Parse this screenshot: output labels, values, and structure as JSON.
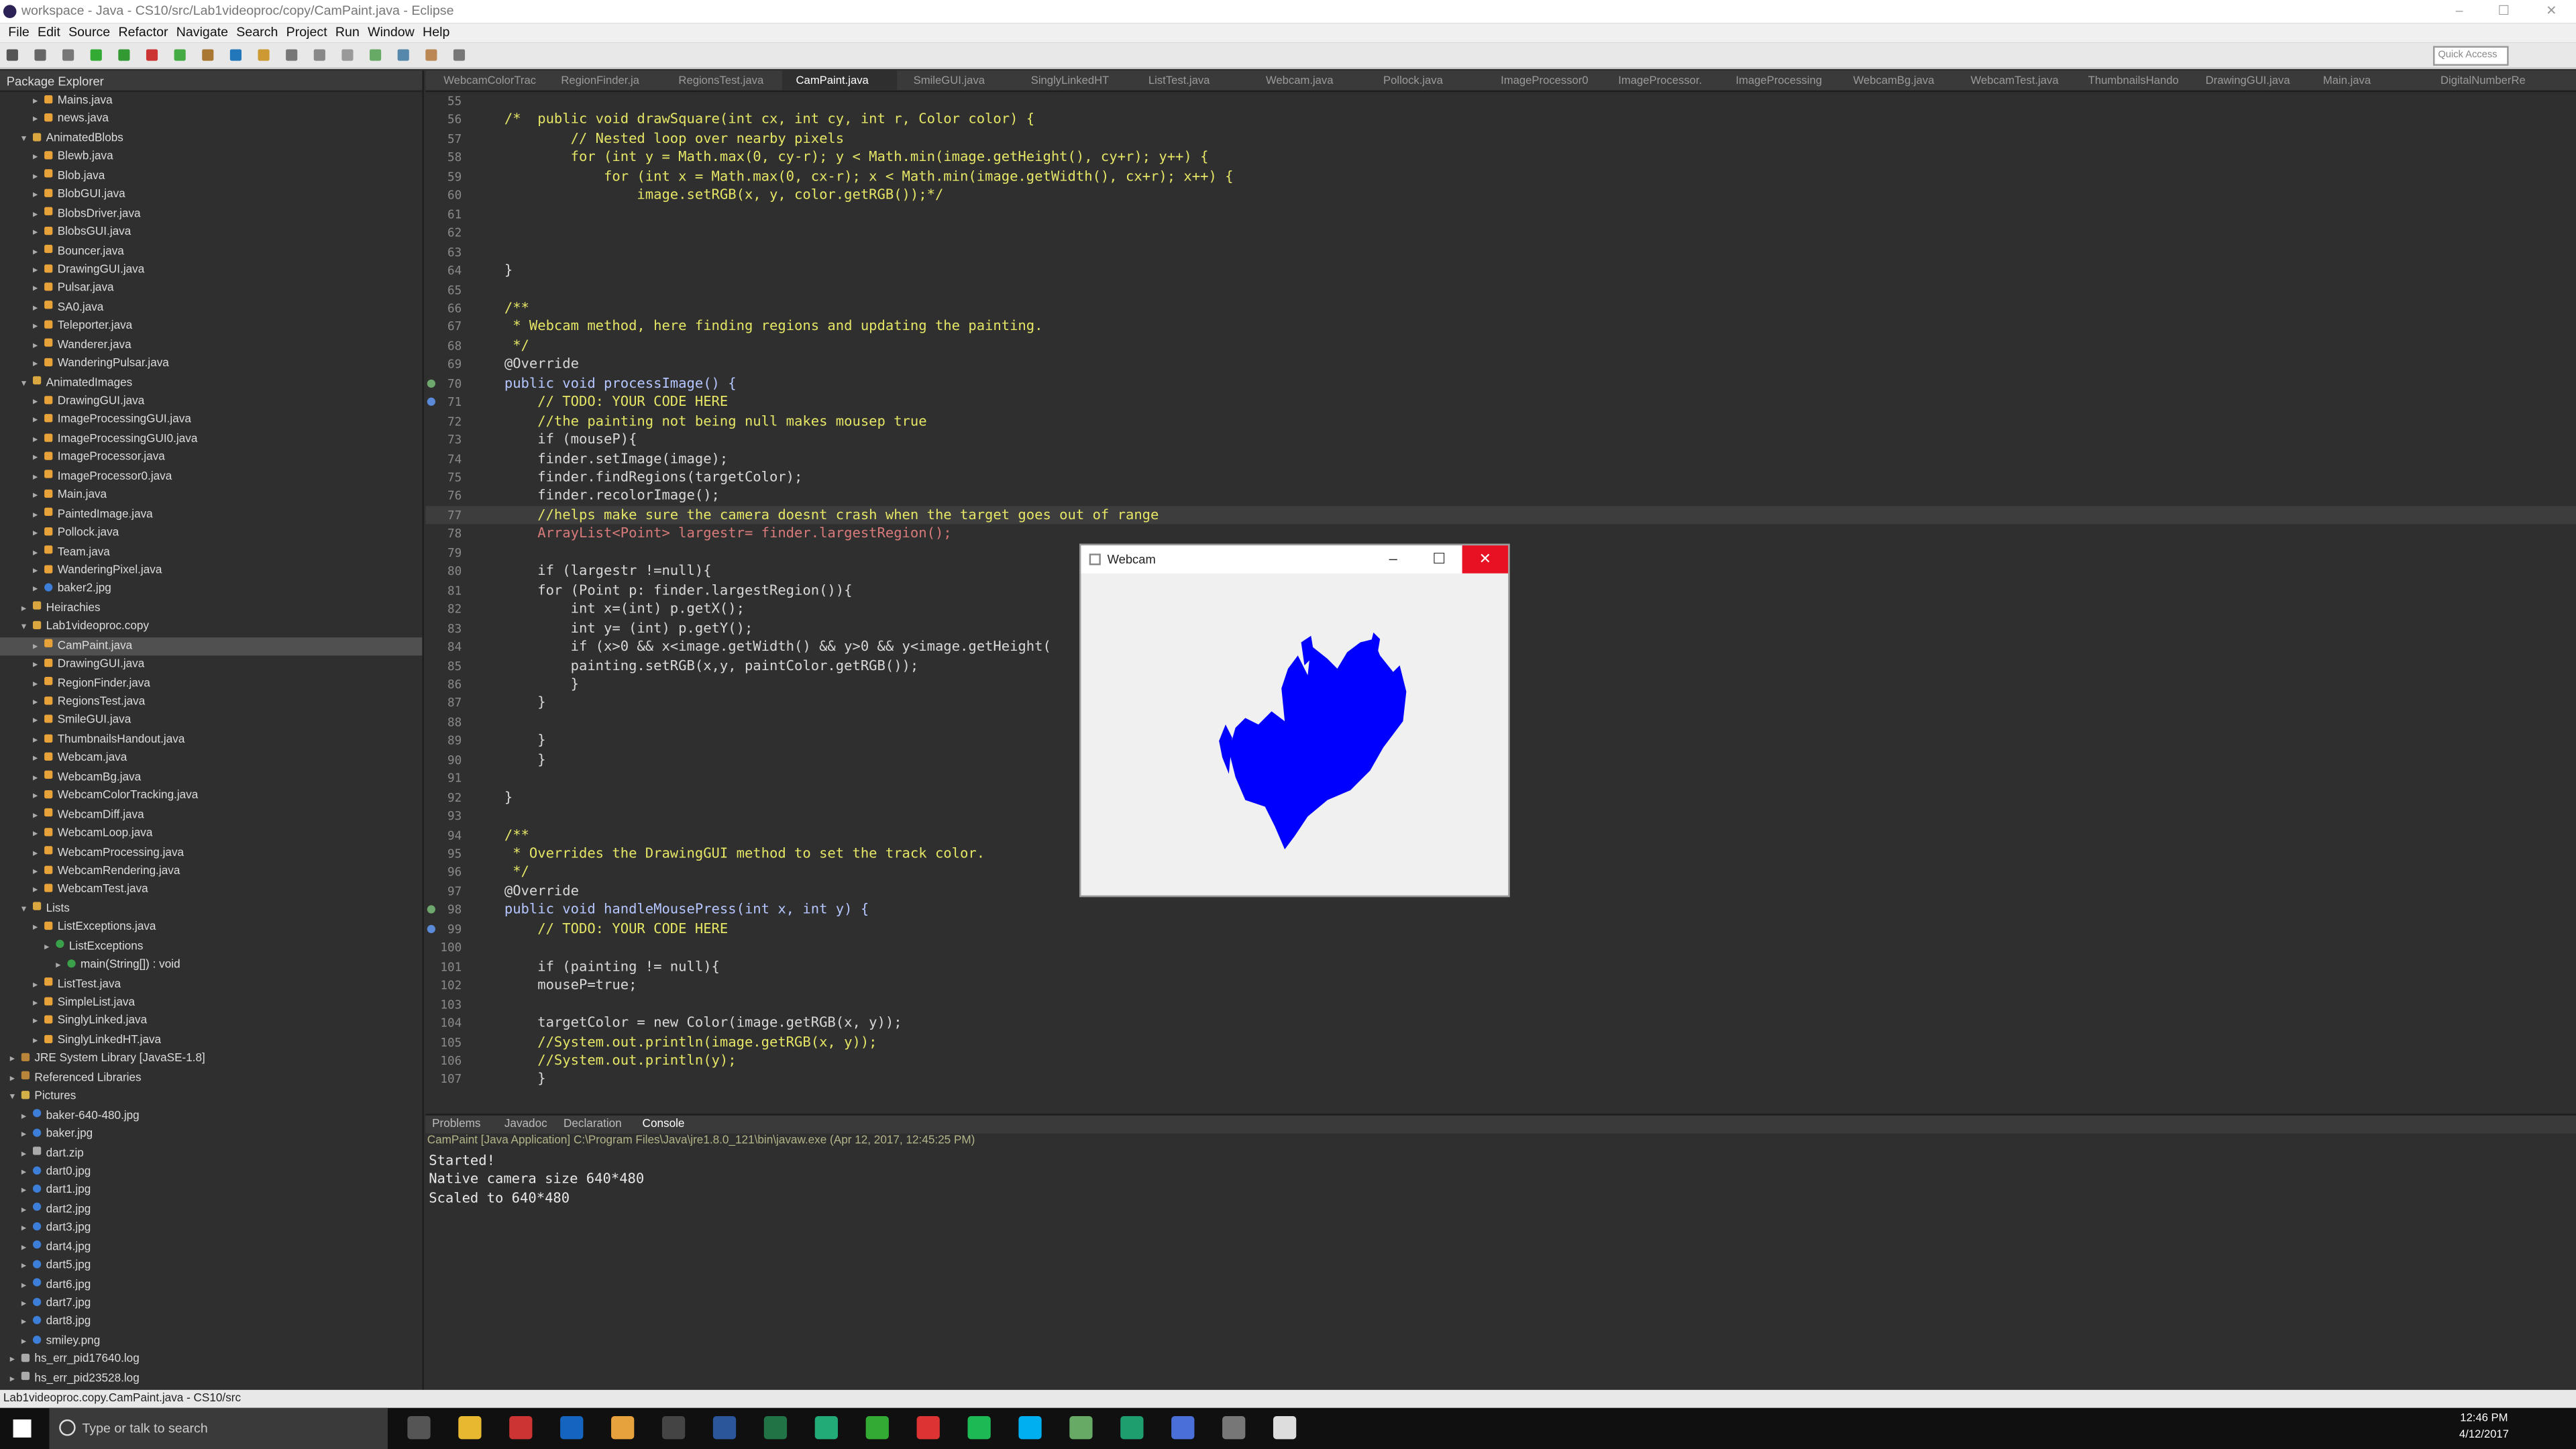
{
  "window": {
    "title": "workspace - Java - CS10/src/Lab1videoproc/copy/CamPaint.java - Eclipse",
    "quick_access": "Quick Access"
  },
  "menu": [
    "File",
    "Edit",
    "Source",
    "Refactor",
    "Navigate",
    "Search",
    "Project",
    "Run",
    "Window",
    "Help"
  ],
  "package_explorer": {
    "title": "Package Explorer"
  },
  "tree": [
    {
      "label": "Mains.java",
      "indent": 2,
      "type": "java"
    },
    {
      "label": "news.java",
      "indent": 2,
      "type": "java"
    },
    {
      "label": "AnimatedBlobs",
      "indent": 1,
      "type": "pkg",
      "open": true
    },
    {
      "label": "Blewb.java",
      "indent": 2,
      "type": "java"
    },
    {
      "label": "Blob.java",
      "indent": 2,
      "type": "java"
    },
    {
      "label": "BlobGUI.java",
      "indent": 2,
      "type": "java"
    },
    {
      "label": "BlobsDriver.java",
      "indent": 2,
      "type": "java"
    },
    {
      "label": "BlobsGUI.java",
      "indent": 2,
      "type": "java"
    },
    {
      "label": "Bouncer.java",
      "indent": 2,
      "type": "java"
    },
    {
      "label": "DrawingGUI.java",
      "indent": 2,
      "type": "java"
    },
    {
      "label": "Pulsar.java",
      "indent": 2,
      "type": "java"
    },
    {
      "label": "SA0.java",
      "indent": 2,
      "type": "java"
    },
    {
      "label": "Teleporter.java",
      "indent": 2,
      "type": "java"
    },
    {
      "label": "Wanderer.java",
      "indent": 2,
      "type": "java"
    },
    {
      "label": "WanderingPulsar.java",
      "indent": 2,
      "type": "java"
    },
    {
      "label": "AnimatedImages",
      "indent": 1,
      "type": "pkg",
      "open": true
    },
    {
      "label": "DrawingGUI.java",
      "indent": 2,
      "type": "java"
    },
    {
      "label": "ImageProcessingGUI.java",
      "indent": 2,
      "type": "java"
    },
    {
      "label": "ImageProcessingGUI0.java",
      "indent": 2,
      "type": "java"
    },
    {
      "label": "ImageProcessor.java",
      "indent": 2,
      "type": "java"
    },
    {
      "label": "ImageProcessor0.java",
      "indent": 2,
      "type": "java"
    },
    {
      "label": "Main.java",
      "indent": 2,
      "type": "java"
    },
    {
      "label": "PaintedImage.java",
      "indent": 2,
      "type": "java"
    },
    {
      "label": "Pollock.java",
      "indent": 2,
      "type": "java"
    },
    {
      "label": "Team.java",
      "indent": 2,
      "type": "java"
    },
    {
      "label": "WanderingPixel.java",
      "indent": 2,
      "type": "java"
    },
    {
      "label": "baker2.jpg",
      "indent": 2,
      "type": "img"
    },
    {
      "label": "Heirachies",
      "indent": 1,
      "type": "pkg"
    },
    {
      "label": "Lab1videoproc.copy",
      "indent": 1,
      "type": "pkg",
      "open": true
    },
    {
      "label": "CamPaint.java",
      "indent": 2,
      "type": "java",
      "selected": true
    },
    {
      "label": "DrawingGUI.java",
      "indent": 2,
      "type": "java"
    },
    {
      "label": "RegionFinder.java",
      "indent": 2,
      "type": "java"
    },
    {
      "label": "RegionsTest.java",
      "indent": 2,
      "type": "java"
    },
    {
      "label": "SmileGUI.java",
      "indent": 2,
      "type": "java"
    },
    {
      "label": "ThumbnailsHandout.java",
      "indent": 2,
      "type": "java"
    },
    {
      "label": "Webcam.java",
      "indent": 2,
      "type": "java"
    },
    {
      "label": "WebcamBg.java",
      "indent": 2,
      "type": "java"
    },
    {
      "label": "WebcamColorTracking.java",
      "indent": 2,
      "type": "java"
    },
    {
      "label": "WebcamDiff.java",
      "indent": 2,
      "type": "java"
    },
    {
      "label": "WebcamLoop.java",
      "indent": 2,
      "type": "java"
    },
    {
      "label": "WebcamProcessing.java",
      "indent": 2,
      "type": "java"
    },
    {
      "label": "WebcamRendering.java",
      "indent": 2,
      "type": "java"
    },
    {
      "label": "WebcamTest.java",
      "indent": 2,
      "type": "java"
    },
    {
      "label": "Lists",
      "indent": 1,
      "type": "pkg",
      "open": true
    },
    {
      "label": "ListExceptions.java",
      "indent": 2,
      "type": "java",
      "open": true
    },
    {
      "label": "ListExceptions",
      "indent": 3,
      "type": "class"
    },
    {
      "label": "main(String[]) : void",
      "indent": 4,
      "type": "method"
    },
    {
      "label": "ListTest.java",
      "indent": 2,
      "type": "java"
    },
    {
      "label": "SimpleList.java",
      "indent": 2,
      "type": "java"
    },
    {
      "label": "SinglyLinked.java",
      "indent": 2,
      "type": "java"
    },
    {
      "label": "SinglyLinkedHT.java",
      "indent": 2,
      "type": "java"
    },
    {
      "label": "JRE System Library [JavaSE-1.8]",
      "indent": 0,
      "type": "lib"
    },
    {
      "label": "Referenced Libraries",
      "indent": 0,
      "type": "lib"
    },
    {
      "label": "Pictures",
      "indent": 0,
      "type": "folder",
      "open": true
    },
    {
      "label": "baker-640-480.jpg",
      "indent": 1,
      "type": "img"
    },
    {
      "label": "baker.jpg",
      "indent": 1,
      "type": "img"
    },
    {
      "label": "dart.zip",
      "indent": 1,
      "type": "file"
    },
    {
      "label": "dart0.jpg",
      "indent": 1,
      "type": "img"
    },
    {
      "label": "dart1.jpg",
      "indent": 1,
      "type": "img"
    },
    {
      "label": "dart2.jpg",
      "indent": 1,
      "type": "img"
    },
    {
      "label": "dart3.jpg",
      "indent": 1,
      "type": "img"
    },
    {
      "label": "dart4.jpg",
      "indent": 1,
      "type": "img"
    },
    {
      "label": "dart5.jpg",
      "indent": 1,
      "type": "img"
    },
    {
      "label": "dart6.jpg",
      "indent": 1,
      "type": "img"
    },
    {
      "label": "dart7.jpg",
      "indent": 1,
      "type": "img"
    },
    {
      "label": "dart8.jpg",
      "indent": 1,
      "type": "img"
    },
    {
      "label": "smiley.png",
      "indent": 1,
      "type": "img"
    },
    {
      "label": "hs_err_pid17640.log",
      "indent": 0,
      "type": "file"
    },
    {
      "label": "hs_err_pid23528.log",
      "indent": 0,
      "type": "file"
    }
  ],
  "tabs": [
    "WebcamColorTrac",
    "RegionFinder.ja",
    "RegionsTest.java",
    "CamPaint.java",
    "SmileGUI.java",
    "SinglyLinkedHT",
    "ListTest.java",
    "Webcam.java",
    "Pollock.java",
    "ImageProcessor0",
    "ImageProcessor.",
    "ImageProcessing",
    "WebcamBg.java",
    "WebcamTest.java",
    "ThumbnailsHando",
    "DrawingGUI.java",
    "Main.java",
    "DigitalNumberRe"
  ],
  "active_tab": "CamPaint.java",
  "code": [
    {
      "n": "55",
      "t": "",
      "k": ""
    },
    {
      "n": "56",
      "t": "/*  public void drawSquare(int cx, int cy, int r, Color color) {",
      "k": "com"
    },
    {
      "n": "57",
      "t": "        // Nested loop over nearby pixels",
      "k": "com"
    },
    {
      "n": "58",
      "t": "        for (int y = Math.max(0, cy-r); y < Math.min(image.getHeight(), cy+r); y++) {",
      "k": "com"
    },
    {
      "n": "59",
      "t": "            for (int x = Math.max(0, cx-r); x < Math.min(image.getWidth(), cx+r); x++) {",
      "k": "com"
    },
    {
      "n": "60",
      "t": "                image.setRGB(x, y, color.getRGB());*/",
      "k": "com"
    },
    {
      "n": "61",
      "t": "",
      "k": ""
    },
    {
      "n": "62",
      "t": "",
      "k": ""
    },
    {
      "n": "63",
      "t": "",
      "k": ""
    },
    {
      "n": "64",
      "t": "}",
      "k": ""
    },
    {
      "n": "65",
      "t": "",
      "k": ""
    },
    {
      "n": "66",
      "t": "/**",
      "k": "com"
    },
    {
      "n": "67",
      "t": " * Webcam method, here finding regions and updating the painting.",
      "k": "com"
    },
    {
      "n": "68",
      "t": " */",
      "k": "com"
    },
    {
      "n": "69",
      "t": "@Override",
      "k": ""
    },
    {
      "n": "70",
      "t": "public void processImage() {",
      "k": "kw"
    },
    {
      "n": "71",
      "t": "    // TODO: YOUR CODE HERE",
      "k": "com"
    },
    {
      "n": "72",
      "t": "    //the painting not being null makes mousep true",
      "k": "com"
    },
    {
      "n": "73",
      "t": "    if (mouseP){",
      "k": ""
    },
    {
      "n": "74",
      "t": "    finder.setImage(image);",
      "k": ""
    },
    {
      "n": "75",
      "t": "    finder.findRegions(targetColor);",
      "k": ""
    },
    {
      "n": "76",
      "t": "    finder.recolorImage();",
      "k": ""
    },
    {
      "n": "77",
      "t": "    //helps make sure the camera doesnt crash when the target goes out of range",
      "k": "com",
      "cur": true
    },
    {
      "n": "78",
      "t": "    ArrayList<Point> largestr= finder.largestRegion();",
      "k": "type"
    },
    {
      "n": "79",
      "t": "",
      "k": ""
    },
    {
      "n": "80",
      "t": "    if (largestr !=null){",
      "k": ""
    },
    {
      "n": "81",
      "t": "    for (Point p: finder.largestRegion()){",
      "k": ""
    },
    {
      "n": "82",
      "t": "        int x=(int) p.getX();",
      "k": ""
    },
    {
      "n": "83",
      "t": "        int y= (int) p.getY();",
      "k": ""
    },
    {
      "n": "84",
      "t": "        if (x>0 && x<image.getWidth() && y>0 && y<image.getHeight(",
      "k": ""
    },
    {
      "n": "85",
      "t": "        painting.setRGB(x,y, paintColor.getRGB());",
      "k": ""
    },
    {
      "n": "86",
      "t": "        }",
      "k": ""
    },
    {
      "n": "87",
      "t": "    }",
      "k": ""
    },
    {
      "n": "88",
      "t": "",
      "k": ""
    },
    {
      "n": "89",
      "t": "    }",
      "k": ""
    },
    {
      "n": "90",
      "t": "    }",
      "k": ""
    },
    {
      "n": "91",
      "t": "",
      "k": ""
    },
    {
      "n": "92",
      "t": "}",
      "k": ""
    },
    {
      "n": "93",
      "t": "",
      "k": ""
    },
    {
      "n": "94",
      "t": "/**",
      "k": "com"
    },
    {
      "n": "95",
      "t": " * Overrides the DrawingGUI method to set the track color.",
      "k": "com"
    },
    {
      "n": "96",
      "t": " */",
      "k": "com"
    },
    {
      "n": "97",
      "t": "@Override",
      "k": ""
    },
    {
      "n": "98",
      "t": "public void handleMousePress(int x, int y) {",
      "k": "kw"
    },
    {
      "n": "99",
      "t": "    // TODO: YOUR CODE HERE",
      "k": "com"
    },
    {
      "n": "100",
      "t": "",
      "k": ""
    },
    {
      "n": "101",
      "t": "    if (painting != null){",
      "k": ""
    },
    {
      "n": "102",
      "t": "    mouseP=true;",
      "k": ""
    },
    {
      "n": "103",
      "t": "",
      "k": ""
    },
    {
      "n": "104",
      "t": "    targetColor = new Color(image.getRGB(x, y));",
      "k": ""
    },
    {
      "n": "105",
      "t": "    //System.out.println(image.getRGB(x, y));",
      "k": "com"
    },
    {
      "n": "106",
      "t": "    //System.out.println(y);",
      "k": "com"
    },
    {
      "n": "107",
      "t": "    }",
      "k": ""
    }
  ],
  "webcam": {
    "title": "Webcam",
    "min": "–",
    "max": "☐",
    "close": "✕"
  },
  "console": {
    "tabs": [
      "Problems",
      "Javadoc",
      "Declaration",
      "Console"
    ],
    "info": "CamPaint [Java Application] C:\\Program Files\\Java\\jre1.8.0_121\\bin\\javaw.exe (Apr 12, 2017, 12:45:25 PM)",
    "output": [
      "Started!",
      "Native camera size 640*480",
      "Scaled to 640*480"
    ]
  },
  "status": "Lab1videoproc.copy.CamPaint.java - CS10/src",
  "taskbar": {
    "search": "Type or talk to search",
    "time": "12:46 PM",
    "date": "4/12/2017"
  },
  "colors": {
    "paint": "#0000ff",
    "close": "#e81123",
    "comment": "#e5e566"
  }
}
